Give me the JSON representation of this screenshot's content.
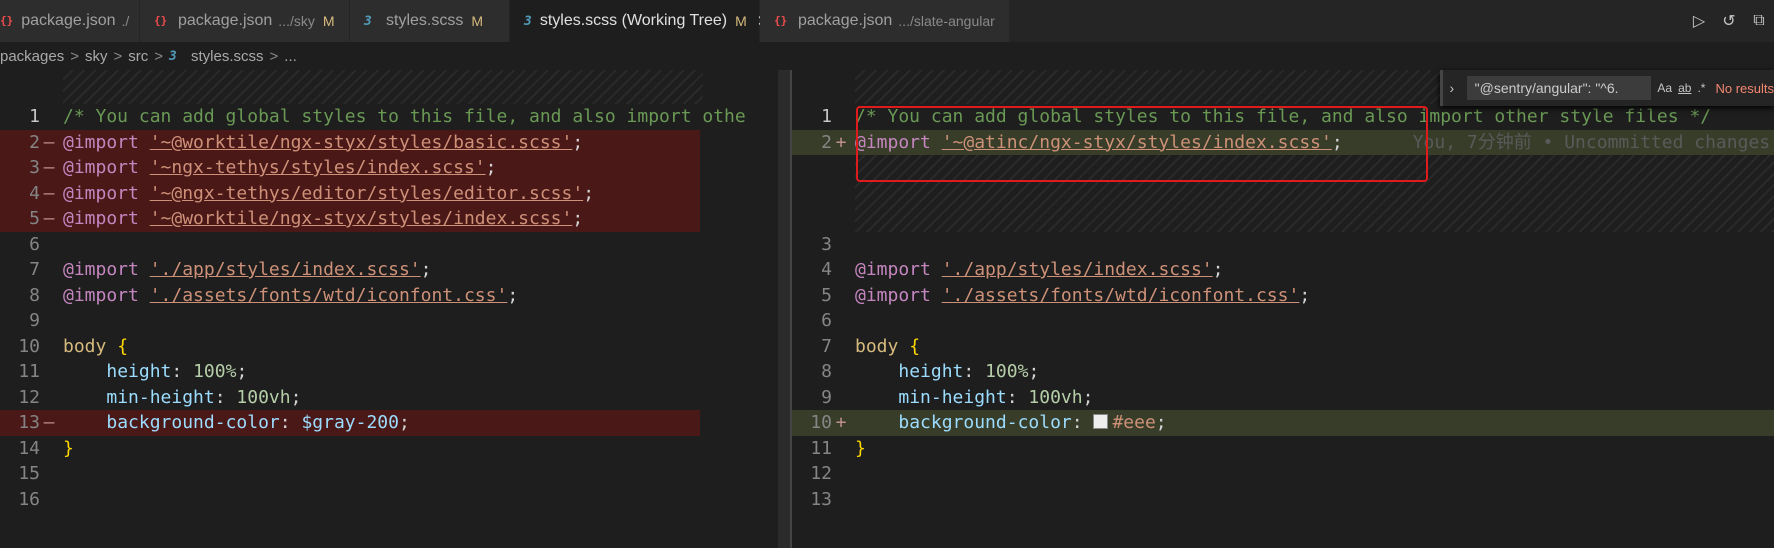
{
  "tabs": [
    {
      "label": "package.json",
      "desc": "./",
      "modified": "",
      "icon": "json-icon",
      "active": false
    },
    {
      "label": "package.json",
      "desc": ".../sky",
      "modified": "M",
      "icon": "json-icon",
      "active": false
    },
    {
      "label": "styles.scss",
      "desc": "",
      "modified": "M",
      "icon": "css-icon",
      "active": false
    },
    {
      "label": "styles.scss (Working Tree)",
      "desc": "",
      "modified": "M",
      "icon": "css-icon",
      "active": true,
      "close": "✕"
    },
    {
      "label": "package.json",
      "desc": ".../slate-angular",
      "modified": "",
      "icon": "json-icon",
      "active": false
    }
  ],
  "tab_actions": [
    {
      "name": "run-icon",
      "glyph": "▷"
    },
    {
      "name": "history-icon",
      "glyph": "↺"
    },
    {
      "name": "split-icon",
      "glyph": "⧉"
    }
  ],
  "breadcrumb": {
    "items": [
      "packages",
      "sky",
      "src",
      "styles.scss",
      "..."
    ],
    "sep": ">"
  },
  "left_editor": {
    "lines": [
      {
        "num": "1",
        "marker": "",
        "tokens": [
          {
            "t": "c",
            "v": "/* You can add global styles to this file, and also import othe"
          }
        ]
      },
      {
        "num": "2",
        "marker": "—",
        "removed": true,
        "tokens": [
          {
            "t": "kw",
            "v": "@import "
          },
          {
            "t": "str",
            "v": "'~@worktile/ngx-styx/styles/basic.scss'"
          },
          {
            "t": "p",
            "v": ";"
          }
        ]
      },
      {
        "num": "3",
        "marker": "—",
        "removed": true,
        "tokens": [
          {
            "t": "kw",
            "v": "@import "
          },
          {
            "t": "str",
            "v": "'~ngx-tethys/styles/index.scss'"
          },
          {
            "t": "p",
            "v": ";"
          }
        ]
      },
      {
        "num": "4",
        "marker": "—",
        "removed": true,
        "tokens": [
          {
            "t": "kw",
            "v": "@import "
          },
          {
            "t": "str",
            "v": "'~@ngx-tethys/editor/styles/editor.scss'"
          },
          {
            "t": "p",
            "v": ";"
          }
        ]
      },
      {
        "num": "5",
        "marker": "—",
        "removed": true,
        "tokens": [
          {
            "t": "kw",
            "v": "@import "
          },
          {
            "t": "str",
            "v": "'~@worktile/ngx-styx/styles/index.scss'"
          },
          {
            "t": "p",
            "v": ";"
          }
        ]
      },
      {
        "num": "6",
        "marker": "",
        "tokens": []
      },
      {
        "num": "7",
        "marker": "",
        "tokens": [
          {
            "t": "kw",
            "v": "@import "
          },
          {
            "t": "str",
            "v": "'./app/styles/index.scss'"
          },
          {
            "t": "p",
            "v": ";"
          }
        ]
      },
      {
        "num": "8",
        "marker": "",
        "tokens": [
          {
            "t": "kw",
            "v": "@import "
          },
          {
            "t": "str",
            "v": "'./assets/fonts/wtd/iconfont.css'"
          },
          {
            "t": "p",
            "v": ";"
          }
        ]
      },
      {
        "num": "9",
        "marker": "",
        "tokens": []
      },
      {
        "num": "10",
        "marker": "",
        "tokens": [
          {
            "t": "sel",
            "v": "body "
          },
          {
            "t": "brace",
            "v": "{"
          }
        ]
      },
      {
        "num": "11",
        "marker": "",
        "tokens": [
          {
            "t": "p",
            "v": "    "
          },
          {
            "t": "prop",
            "v": "height"
          },
          {
            "t": "p",
            "v": ": "
          },
          {
            "t": "num",
            "v": "100%"
          },
          {
            "t": "p",
            "v": ";"
          }
        ]
      },
      {
        "num": "12",
        "marker": "",
        "tokens": [
          {
            "t": "p",
            "v": "    "
          },
          {
            "t": "prop",
            "v": "min-height"
          },
          {
            "t": "p",
            "v": ": "
          },
          {
            "t": "num",
            "v": "100vh"
          },
          {
            "t": "p",
            "v": ";"
          }
        ]
      },
      {
        "num": "13",
        "marker": "—",
        "removed": true,
        "tokens": [
          {
            "t": "p",
            "v": "    "
          },
          {
            "t": "prop",
            "v": "background-color"
          },
          {
            "t": "p",
            "v": ": "
          },
          {
            "t": "var",
            "v": "$gray-200"
          },
          {
            "t": "p",
            "v": ";"
          }
        ]
      },
      {
        "num": "14",
        "marker": "",
        "tokens": [
          {
            "t": "brace",
            "v": "}"
          }
        ]
      },
      {
        "num": "15",
        "marker": "",
        "tokens": []
      },
      {
        "num": "16",
        "marker": "",
        "tokens": []
      }
    ]
  },
  "right_editor": {
    "lines": [
      {
        "num": "1",
        "marker": "",
        "tokens": [
          {
            "t": "c",
            "v": "/* You can add global styles to this file, and also import other style files */"
          }
        ]
      },
      {
        "num": "2",
        "marker": "+",
        "added": true,
        "tokens": [
          {
            "t": "kw",
            "v": "@import "
          },
          {
            "t": "str",
            "v": "'~@atinc/ngx-styx/styles/index.scss'"
          },
          {
            "t": "p",
            "v": ";"
          }
        ],
        "blame": "You, 7分钟前 • Uncommitted changes"
      },
      {
        "num": "3",
        "marker": "",
        "tokens": []
      },
      {
        "num": "4",
        "marker": "",
        "tokens": [
          {
            "t": "kw",
            "v": "@import "
          },
          {
            "t": "str",
            "v": "'./app/styles/index.scss'"
          },
          {
            "t": "p",
            "v": ";"
          }
        ]
      },
      {
        "num": "5",
        "marker": "",
        "tokens": [
          {
            "t": "kw",
            "v": "@import "
          },
          {
            "t": "str",
            "v": "'./assets/fonts/wtd/iconfont.css'"
          },
          {
            "t": "p",
            "v": ";"
          }
        ]
      },
      {
        "num": "6",
        "marker": "",
        "tokens": []
      },
      {
        "num": "7",
        "marker": "",
        "tokens": [
          {
            "t": "sel",
            "v": "body "
          },
          {
            "t": "brace",
            "v": "{"
          }
        ]
      },
      {
        "num": "8",
        "marker": "",
        "tokens": [
          {
            "t": "p",
            "v": "    "
          },
          {
            "t": "prop",
            "v": "height"
          },
          {
            "t": "p",
            "v": ": "
          },
          {
            "t": "num",
            "v": "100%"
          },
          {
            "t": "p",
            "v": ";"
          }
        ]
      },
      {
        "num": "9",
        "marker": "",
        "tokens": [
          {
            "t": "p",
            "v": "    "
          },
          {
            "t": "prop",
            "v": "min-height"
          },
          {
            "t": "p",
            "v": ": "
          },
          {
            "t": "num",
            "v": "100vh"
          },
          {
            "t": "p",
            "v": ";"
          }
        ]
      },
      {
        "num": "10",
        "marker": "+",
        "added": true,
        "tokens": [
          {
            "t": "p",
            "v": "    "
          },
          {
            "t": "prop",
            "v": "background-color"
          },
          {
            "t": "p",
            "v": ": "
          },
          {
            "t": "swatch",
            "v": ""
          },
          {
            "t": "str2",
            "v": "#eee"
          },
          {
            "t": "p",
            "v": ";"
          }
        ]
      },
      {
        "num": "11",
        "marker": "",
        "tokens": [
          {
            "t": "brace",
            "v": "}"
          }
        ]
      },
      {
        "num": "12",
        "marker": "",
        "tokens": []
      },
      {
        "num": "13",
        "marker": "",
        "tokens": []
      }
    ]
  },
  "find_widget": {
    "query": "\"@sentry/angular\": \"^6.",
    "options": [
      "Aa",
      "ab",
      ".*"
    ],
    "result": "No results"
  },
  "colors": {
    "removed_bg": "#4b1818",
    "added_bg": "#373d29",
    "highlight_box": "#e01b1b"
  }
}
